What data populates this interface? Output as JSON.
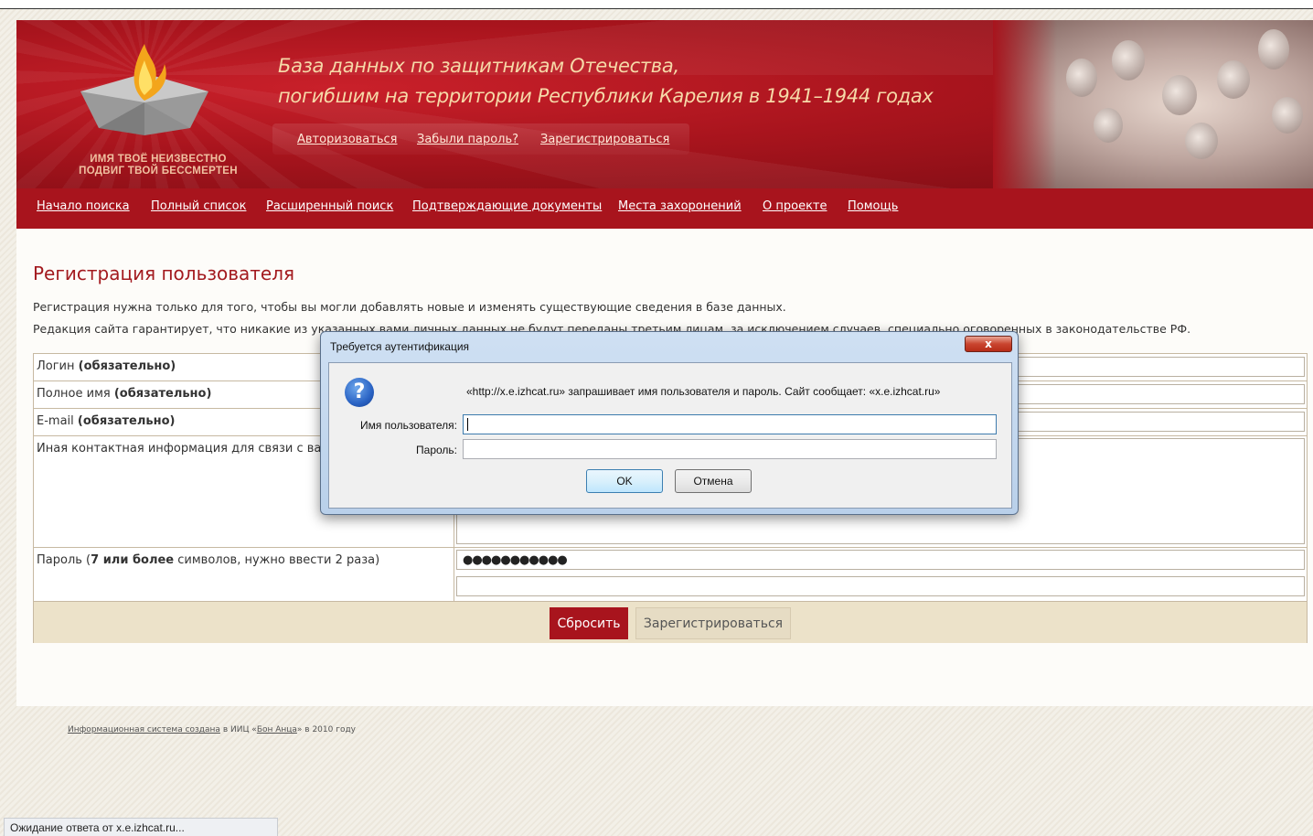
{
  "site": {
    "title_line1": "База данных по защитникам Отечества,",
    "title_line2": "погибшим на территории Республики Карелия в 1941–1944 годах",
    "logo_text_line1": "ИМЯ ТВОЁ НЕИЗВЕСТНО",
    "logo_text_line2": "ПОДВИГ ТВОЙ БЕССМЕРТЕН"
  },
  "auth_links": [
    "Авторизоваться",
    "Забыли пароль?",
    "Зарегистрироваться"
  ],
  "nav": [
    "Начало поиска",
    "Полный список",
    "Расширенный поиск",
    "Подтверждающие документы",
    "Места захоронений",
    "О проекте",
    "Помощь"
  ],
  "page": {
    "title": "Регистрация пользователя",
    "intro1": "Регистрация нужна только для того, чтобы вы могли добавлять новые и изменять существующие сведения в базе данных.",
    "intro2": "Редакция сайта гарантирует, что никакие из указанных вами личных данных не будут переданы третьим лицам, за исключением случаев, специально оговоренных в законодательстве РФ."
  },
  "form": {
    "login_label": "Логин ",
    "login_req": "(обязательно)",
    "fullname_label": "Полное имя ",
    "fullname_req": "(обязательно)",
    "email_label": "E-mail ",
    "email_req": "(обязательно)",
    "contact_label": "Иная контактная информация для связи с вами",
    "password_label_a": "Пароль (",
    "password_label_b": "7 или более",
    "password_label_c": " символов, нужно ввести 2 раза)",
    "password_value": "●●●●●●●●●●●",
    "reset_label": "Сбросить",
    "register_label": "Зарегистрироваться"
  },
  "footer": {
    "link1": "Информационная система создана",
    "text1": " в ИИЦ «",
    "link2": "Бон Анца",
    "text2": "» в 2010 году"
  },
  "status": "Ожидание ответа от x.e.izhcat.ru...",
  "dialog": {
    "title": "Требуется аутентификация",
    "close": "x",
    "icon": "?",
    "message": "«http://x.e.izhcat.ru» запрашивает имя пользователя и пароль. Сайт сообщает: «x.e.izhcat.ru»",
    "username_label": "Имя пользователя:",
    "password_label": "Пароль:",
    "ok_label": "OK",
    "cancel_label": "Отмена"
  },
  "colors": {
    "brand_red": "#a8141d",
    "title_red": "#a31a1f",
    "header_title": "#f6d9a8",
    "form_footer_bg": "#ece2c9"
  }
}
